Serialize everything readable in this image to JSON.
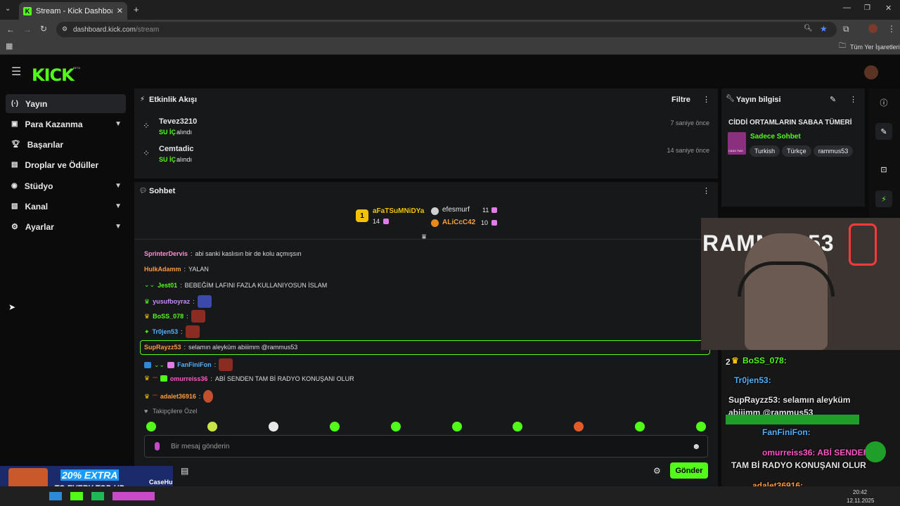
{
  "browser": {
    "tab_title": "Stream - Kick Dashboard",
    "url_domain": "dashboard.kick.com",
    "url_path": "/stream",
    "bookmarks_label": "Tüm Yer İşaretleri"
  },
  "brand": {
    "logo": "KICK",
    "beta": "BETA",
    "accent": "#53fc18"
  },
  "sidebar": {
    "items": [
      {
        "label": "Yayın",
        "icon": "broadcast-icon"
      },
      {
        "label": "Para Kazanma",
        "icon": "money-icon"
      },
      {
        "label": "Başarılar",
        "icon": "trophy-icon"
      },
      {
        "label": "Droplar ve Ödüller",
        "icon": "gift-icon"
      },
      {
        "label": "Stüdyo",
        "icon": "studio-icon"
      },
      {
        "label": "Kanal",
        "icon": "channel-icon"
      },
      {
        "label": "Ayarlar",
        "icon": "gear-icon"
      }
    ]
  },
  "activity": {
    "title": "Etkinlik Akışı",
    "filter": "Filtre",
    "events": [
      {
        "user": "Tevez3210",
        "action_bold": "SU İÇ",
        "action": "alındı",
        "time": "7 saniye önce"
      },
      {
        "user": "Cemtadic",
        "action_bold": "SU İÇ",
        "action": "alındı",
        "time": "14 saniye önce"
      }
    ]
  },
  "chat": {
    "title": "Sohbet",
    "leaderboard": {
      "rank1": "1",
      "first_user": "aFaTSuMNiDYa",
      "first_count": "14",
      "second_user": "efesmurf",
      "second_count": "11",
      "third_user": "ALiCcC42",
      "third_count": "10"
    },
    "messages": [
      {
        "user": "SprinterDervis",
        "text": "abi sanki kaslısın bir de kolu açmışsın",
        "color": "#ff8fd2"
      },
      {
        "user": "HulkAdamm",
        "text": "YALAN",
        "color": "#ff9a3c"
      },
      {
        "user": "Jest01",
        "text": "BEBEĞİM LAFINI FAZLA KULLANIYOSUN İSLAM",
        "color": "#53fc18"
      },
      {
        "user": "yusufboyraz",
        "text": "",
        "color": "#c58cff"
      },
      {
        "user": "BoSS_078",
        "text": "",
        "color": "#53fc18"
      },
      {
        "user": "Tr0jen53",
        "text": "",
        "color": "#4fb3ff"
      },
      {
        "user": "SupRayzz53",
        "text": "selamın aleyküm abiiimm @rammus53",
        "color": "#ff9a3c"
      },
      {
        "user": "FanFiniFon",
        "text": "",
        "color": "#4fb3ff"
      },
      {
        "user": "omurreiss36",
        "text": "ABİ SENDEN TAM Bİ RADYO KONUŞANI OLUR",
        "color": "#ff59c8"
      },
      {
        "user": "adalet36916",
        "text": "",
        "color": "#ff9a3c"
      }
    ],
    "followers_only": "Takipçilere Özel",
    "input_placeholder": "Bir mesaj gönderin",
    "send": "Gönder"
  },
  "stream_info": {
    "title": "Yayın bilgisi",
    "stream_title": "CİDDİ ORTAMLARIN SABAA TÜMERİ",
    "category": "Sadece Sohbet",
    "tags": [
      "Turkish",
      "Türkçe",
      "rammus53"
    ],
    "cover_text": "CIDDI TWC"
  },
  "overlay": {
    "webcam_banner": "RAMMUS53",
    "lines": [
      {
        "text": "BoSS_078:",
        "color": "#53fc18"
      },
      {
        "text": "Tr0jen53:",
        "color": "#4fb3ff"
      },
      {
        "text": "SupRayzz53: selamın aleyküm",
        "color": "#ffffff"
      },
      {
        "text": "abiiimm @rammus53",
        "color": "#ffffff"
      },
      {
        "text": "FanFiniFon:",
        "color": "#4fb3ff"
      },
      {
        "text": "omurreiss36: ABİ SENDEN",
        "color": "#ff59c8"
      },
      {
        "text": "TAM Bİ RADYO KONUŞANI OLUR",
        "color": "#ffffff"
      },
      {
        "text": "adalet36916:",
        "color": "#ff9a3c"
      }
    ],
    "prefix": "2",
    "ad_main": "20% EXTRA",
    "ad_sub": "TO EVERY TOP-UP",
    "ad_brand": "CaseHu"
  },
  "taskbar": {
    "time": "20:42",
    "date": "12.11.2025"
  }
}
